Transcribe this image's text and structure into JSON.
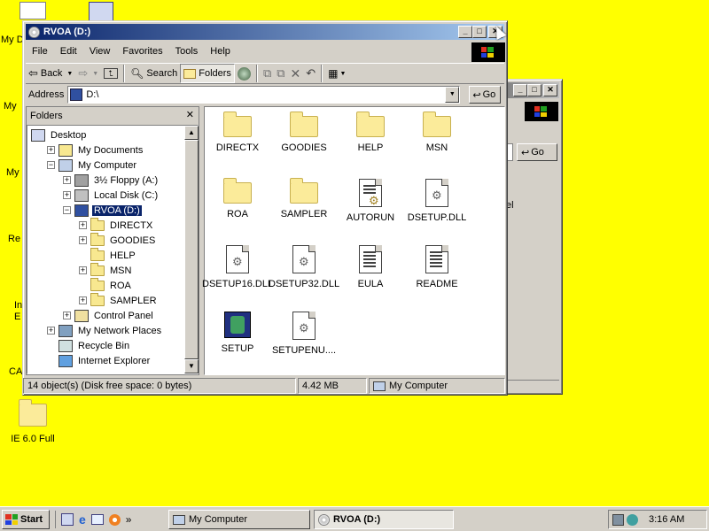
{
  "desktop": {
    "icon_label": "IE 6.0 Full",
    "partial_labels": [
      "My D",
      "My",
      "My",
      "Re",
      "In",
      "E",
      "CA"
    ]
  },
  "back_window": {
    "go_label": "Go",
    "partial_text": "el"
  },
  "window": {
    "title": "RVOA (D:)",
    "menu": [
      "File",
      "Edit",
      "View",
      "Favorites",
      "Tools",
      "Help"
    ],
    "toolbar": {
      "back": "Back",
      "search": "Search",
      "folders": "Folders"
    },
    "address_label": "Address",
    "address_value": "D:\\",
    "go_label": "Go",
    "folders_pane_title": "Folders",
    "tree": [
      {
        "label": "Desktop",
        "indent": 0,
        "expander": "",
        "icon": "desktop-icon"
      },
      {
        "label": "My Documents",
        "indent": 1,
        "expander": "+",
        "icon": "my-documents-icon"
      },
      {
        "label": "My Computer",
        "indent": 1,
        "expander": "-",
        "icon": "my-computer-icon"
      },
      {
        "label": "3½ Floppy (A:)",
        "indent": 2,
        "expander": "+",
        "icon": "floppy-drive-icon"
      },
      {
        "label": "Local Disk (C:)",
        "indent": 2,
        "expander": "+",
        "icon": "hard-disk-icon"
      },
      {
        "label": "RVOA (D:)",
        "indent": 2,
        "expander": "-",
        "icon": "cd-drive-icon",
        "selected": true
      },
      {
        "label": "DIRECTX",
        "indent": 3,
        "expander": "+",
        "icon": "folder-icon"
      },
      {
        "label": "GOODIES",
        "indent": 3,
        "expander": "+",
        "icon": "folder-icon"
      },
      {
        "label": "HELP",
        "indent": 3,
        "expander": "",
        "icon": "folder-icon"
      },
      {
        "label": "MSN",
        "indent": 3,
        "expander": "+",
        "icon": "folder-icon"
      },
      {
        "label": "ROA",
        "indent": 3,
        "expander": "",
        "icon": "folder-icon"
      },
      {
        "label": "SAMPLER",
        "indent": 3,
        "expander": "+",
        "icon": "folder-icon"
      },
      {
        "label": "Control Panel",
        "indent": 2,
        "expander": "+",
        "icon": "control-panel-icon"
      },
      {
        "label": "My Network Places",
        "indent": 1,
        "expander": "+",
        "icon": "network-places-icon"
      },
      {
        "label": "Recycle Bin",
        "indent": 1,
        "expander": "",
        "icon": "recycle-bin-icon"
      },
      {
        "label": "Internet Explorer",
        "indent": 1,
        "expander": "",
        "icon": "internet-explorer-icon"
      }
    ],
    "files": [
      {
        "name": "DIRECTX",
        "type": "folder"
      },
      {
        "name": "GOODIES",
        "type": "folder"
      },
      {
        "name": "HELP",
        "type": "folder"
      },
      {
        "name": "MSN",
        "type": "folder"
      },
      {
        "name": "ROA",
        "type": "folder"
      },
      {
        "name": "SAMPLER",
        "type": "folder"
      },
      {
        "name": "AUTORUN",
        "type": "setup-info"
      },
      {
        "name": "DSETUP.DLL",
        "type": "dll"
      },
      {
        "name": "DSETUP16.DLL",
        "type": "dll"
      },
      {
        "name": "DSETUP32.DLL",
        "type": "dll"
      },
      {
        "name": "EULA",
        "type": "text"
      },
      {
        "name": "README",
        "type": "text"
      },
      {
        "name": "SETUP",
        "type": "app"
      },
      {
        "name": "SETUPENU....",
        "type": "dll"
      }
    ],
    "status": {
      "objects": "14 object(s) (Disk free space: 0 bytes)",
      "size": "4.42 MB",
      "zone": "My Computer"
    }
  },
  "taskbar": {
    "start_label": "Start",
    "tasks": [
      "My Computer",
      "RVOA (D:)"
    ],
    "clock": "3:16 AM",
    "chevron": "»"
  }
}
